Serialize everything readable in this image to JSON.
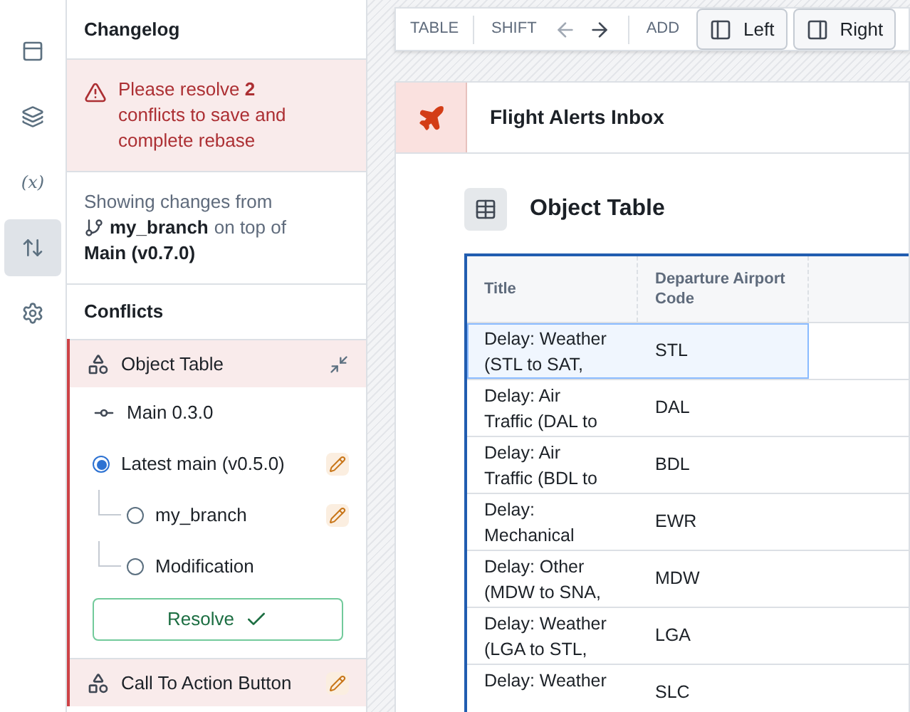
{
  "rail": [
    {
      "kind": "panel",
      "selected": false
    },
    {
      "kind": "layers",
      "selected": false
    },
    {
      "kind": "variable",
      "label": "(x)",
      "selected": false
    },
    {
      "kind": "changes",
      "selected": true
    },
    {
      "kind": "settings",
      "selected": false
    }
  ],
  "changelog": {
    "title": "Changelog",
    "alert": "Please resolve **2** conflicts to save and complete rebase",
    "showing_prefix": "Showing changes from",
    "branch": "my_branch",
    "on_top_of": "on top of",
    "base": "Main (v0.7.0)"
  },
  "conflicts": {
    "title": "Conflicts",
    "items": [
      {
        "name": "Object Table",
        "expanded": true,
        "versions": [
          {
            "kind": "commit",
            "label": "Main 0.3.0",
            "editable": false
          },
          {
            "kind": "radio",
            "label": "Latest main (v0.5.0)",
            "selected": true,
            "editable": true,
            "children": [
              {
                "kind": "radio",
                "label": "my_branch",
                "selected": false,
                "editable": true
              },
              {
                "kind": "radio",
                "label": "Modification",
                "selected": false,
                "editable": false
              }
            ]
          }
        ],
        "resolve": "Resolve"
      },
      {
        "name": "Call To Action Button",
        "expanded": false,
        "editable": true
      }
    ]
  },
  "toolbar": {
    "table": "TABLE",
    "shift": "SHIFT",
    "add": "ADD",
    "buttons": [
      {
        "kind": "left",
        "label": "Left"
      },
      {
        "kind": "right",
        "label": "Right"
      }
    ]
  },
  "card": {
    "title": "Flight Alerts Inbox",
    "widget_title": "Object Table",
    "table": {
      "columns": [
        "Title",
        "Departure Airport Code"
      ],
      "rows": [
        {
          "title": "Delay: Weather (STL to SAT,",
          "code": "STL",
          "selected": true
        },
        {
          "title": "Delay: Air Traffic (DAL to",
          "code": "DAL",
          "selected": false
        },
        {
          "title": "Delay: Air Traffic (BDL to",
          "code": "BDL",
          "selected": false
        },
        {
          "title": "Delay: Mechanical",
          "code": "EWR",
          "selected": false
        },
        {
          "title": "Delay: Other (MDW to SNA,",
          "code": "MDW",
          "selected": false
        },
        {
          "title": "Delay: Weather (LGA to STL,",
          "code": "LGA",
          "selected": false
        },
        {
          "title": "Delay: Weather",
          "code": "SLC",
          "selected": false
        }
      ]
    }
  }
}
